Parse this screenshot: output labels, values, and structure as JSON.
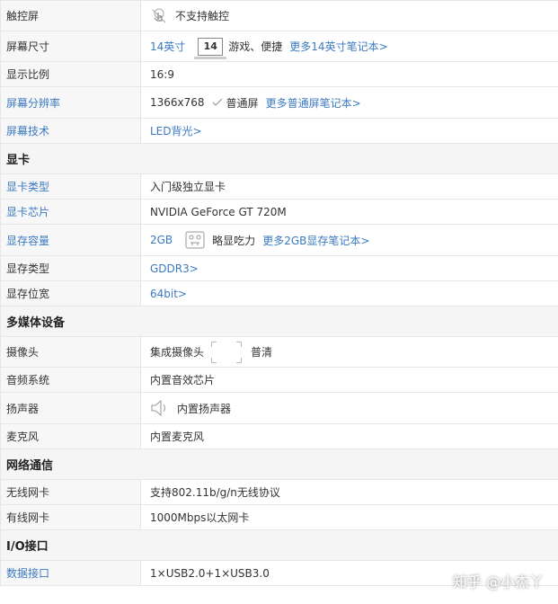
{
  "rows": {
    "touch": {
      "label": "触控屏",
      "value": "不支持触控"
    },
    "size": {
      "label": "屏幕尺寸",
      "value": "14英寸",
      "icon_text": "14",
      "desc": "游戏、便捷",
      "more": "更多14英寸笔记本>"
    },
    "ratio": {
      "label": "显示比例",
      "value": "16:9"
    },
    "resolution": {
      "label": "屏幕分辨率",
      "value": "1366x768",
      "check_text": "普通屏",
      "more": "更多普通屏笔记本>"
    },
    "tech": {
      "label": "屏幕技术",
      "value": "LED背光>"
    }
  },
  "sections": {
    "gpu": "显卡",
    "media": "多媒体设备",
    "network": "网络通信",
    "io": "I/O接口"
  },
  "gpu": {
    "type": {
      "label": "显卡类型",
      "value": "入门级独立显卡"
    },
    "chip": {
      "label": "显卡芯片",
      "value": "NVIDIA GeForce GT 720M"
    },
    "vram": {
      "label": "显存容量",
      "value": "2GB",
      "desc": "略显吃力",
      "more": "更多2GB显存笔记本>"
    },
    "vram_type": {
      "label": "显存类型",
      "value": "GDDR3>"
    },
    "bus": {
      "label": "显存位宽",
      "value": "64bit>"
    }
  },
  "media": {
    "camera": {
      "label": "摄像头",
      "value": "集成摄像头",
      "quality": "普清"
    },
    "audio": {
      "label": "音频系统",
      "value": "内置音效芯片"
    },
    "speaker": {
      "label": "扬声器",
      "value": "内置扬声器"
    },
    "mic": {
      "label": "麦克风",
      "value": "内置麦克风"
    }
  },
  "network": {
    "wifi": {
      "label": "无线网卡",
      "value": "支持802.11b/g/n无线协议"
    },
    "lan": {
      "label": "有线网卡",
      "value": "1000Mbps以太网卡"
    }
  },
  "io": {
    "data": {
      "label": "数据接口",
      "value": "1×USB2.0+1×USB3.0"
    }
  },
  "watermark": "知乎 @小杰丫",
  "colors": {
    "link": "#3b7ac2",
    "label_bg": "#f7f7f7",
    "section_bg": "#f5f5f5",
    "border": "#e6e6e6"
  }
}
